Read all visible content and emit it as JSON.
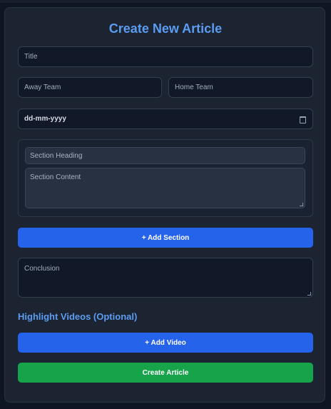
{
  "form": {
    "heading": "Create New Article",
    "title_placeholder": "Title",
    "away_team_placeholder": "Away Team",
    "home_team_placeholder": "Home Team",
    "date_value": "dd-mm-yyyy",
    "section": {
      "heading_placeholder": "Section Heading",
      "content_placeholder": "Section Content"
    },
    "add_section_label": "+ Add Section",
    "conclusion_placeholder": "Conclusion",
    "videos_heading": "Highlight Videos (Optional)",
    "add_video_label": "+ Add Video",
    "create_label": "Create Article"
  },
  "colors": {
    "accent_text": "#5c9cf0",
    "primary_button": "#2563eb",
    "submit_button": "#16a34a",
    "card_background": "#1c2432",
    "input_background": "#111827"
  },
  "icons": {
    "date_picker": "calendar-icon"
  }
}
